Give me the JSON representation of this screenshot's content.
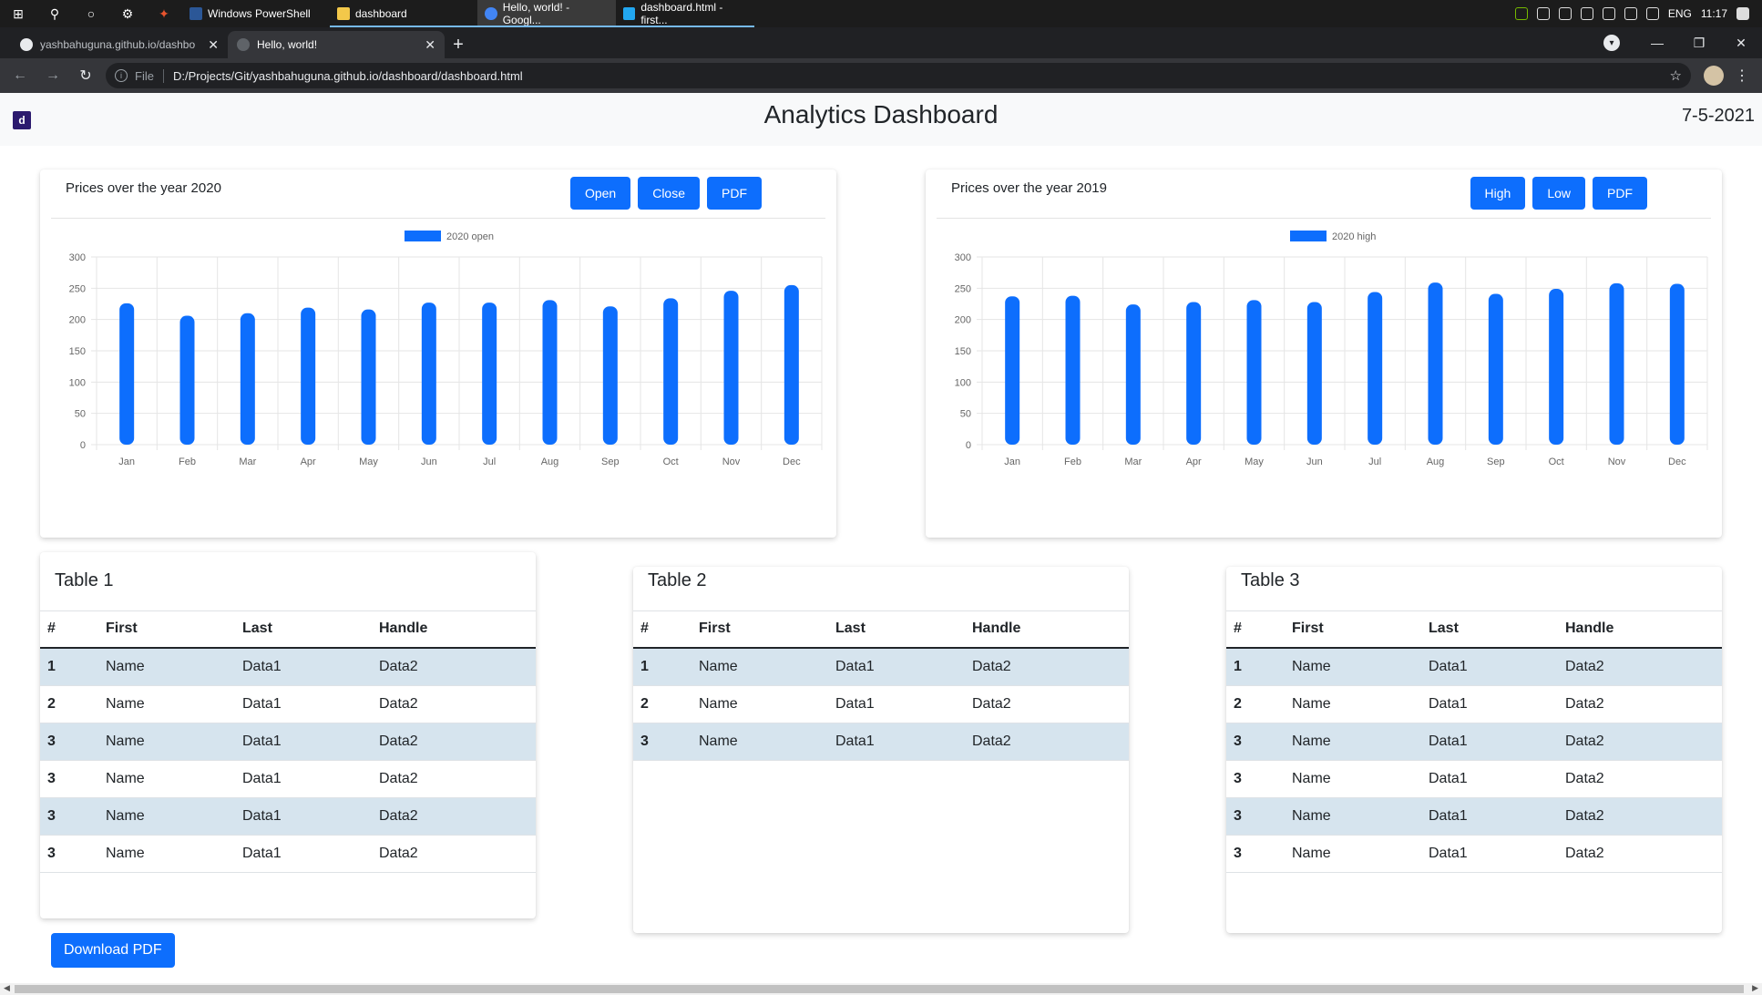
{
  "taskbar": {
    "apps": [
      {
        "label": "Windows PowerShell",
        "icon": "powershell-icon",
        "color": "#2b5797"
      },
      {
        "label": "dashboard",
        "icon": "folder-icon",
        "color": "#f3c84a"
      },
      {
        "label": "Hello, world! - Googl...",
        "icon": "chrome-icon",
        "color": "#4285f4"
      },
      {
        "label": "dashboard.html - first...",
        "icon": "vscode-icon",
        "color": "#22a7f0"
      }
    ],
    "tray": {
      "lang": "ENG",
      "time": "11:17"
    }
  },
  "browser": {
    "tabs": [
      {
        "label": "yashbahuguna.github.io/dashbo",
        "icon": "github-icon"
      },
      {
        "label": "Hello, world!",
        "icon": "globe-icon"
      }
    ],
    "url_scheme": "File",
    "url": "D:/Projects/Git/yashbahuguna.github.io/dashboard/dashboard.html"
  },
  "header": {
    "logo": "d",
    "title": "Analytics Dashboard",
    "date": "7-5-2021"
  },
  "charts": [
    {
      "title": "Prices over the year 2020",
      "buttons": [
        "Open",
        "Close",
        "PDF"
      ],
      "chart_data": {
        "type": "bar",
        "categories": [
          "Jan",
          "Feb",
          "Mar",
          "Apr",
          "May",
          "Jun",
          "Jul",
          "Aug",
          "Sep",
          "Oct",
          "Nov",
          "Dec"
        ],
        "series": [
          {
            "name": "2020 open",
            "values": [
              226,
              206,
              210,
              219,
              216,
              227,
              227,
              231,
              221,
              234,
              246,
              255
            ]
          }
        ],
        "ylim": [
          0,
          300
        ],
        "yticks": [
          0,
          50,
          100,
          150,
          200,
          250,
          300
        ],
        "grid": true,
        "legend": "top-center",
        "color": "#0d6efd"
      }
    },
    {
      "title": "Prices over the year 2019",
      "buttons": [
        "High",
        "Low",
        "PDF"
      ],
      "chart_data": {
        "type": "bar",
        "categories": [
          "Jan",
          "Feb",
          "Mar",
          "Apr",
          "May",
          "Jun",
          "Jul",
          "Aug",
          "Sep",
          "Oct",
          "Nov",
          "Dec"
        ],
        "series": [
          {
            "name": "2020 high",
            "values": [
              237,
              238,
              224,
              228,
              231,
              228,
              244,
              259,
              241,
              249,
              258,
              257
            ]
          }
        ],
        "ylim": [
          0,
          300
        ],
        "yticks": [
          0,
          50,
          100,
          150,
          200,
          250,
          300
        ],
        "grid": true,
        "legend": "top-center",
        "color": "#0d6efd"
      }
    }
  ],
  "tables": [
    {
      "title": "Table 1",
      "headers": [
        "#",
        "First",
        "Last",
        "Handle"
      ],
      "rows": [
        [
          "1",
          "Name",
          "Data1",
          "Data2"
        ],
        [
          "2",
          "Name",
          "Data1",
          "Data2"
        ],
        [
          "3",
          "Name",
          "Data1",
          "Data2"
        ],
        [
          "3",
          "Name",
          "Data1",
          "Data2"
        ],
        [
          "3",
          "Name",
          "Data1",
          "Data2"
        ],
        [
          "3",
          "Name",
          "Data1",
          "Data2"
        ]
      ]
    },
    {
      "title": "Table 2",
      "headers": [
        "#",
        "First",
        "Last",
        "Handle"
      ],
      "rows": [
        [
          "1",
          "Name",
          "Data1",
          "Data2"
        ],
        [
          "2",
          "Name",
          "Data1",
          "Data2"
        ],
        [
          "3",
          "Name",
          "Data1",
          "Data2"
        ]
      ]
    },
    {
      "title": "Table 3",
      "headers": [
        "#",
        "First",
        "Last",
        "Handle"
      ],
      "rows": [
        [
          "1",
          "Name",
          "Data1",
          "Data2"
        ],
        [
          "2",
          "Name",
          "Data1",
          "Data2"
        ],
        [
          "3",
          "Name",
          "Data1",
          "Data2"
        ],
        [
          "3",
          "Name",
          "Data1",
          "Data2"
        ],
        [
          "3",
          "Name",
          "Data1",
          "Data2"
        ],
        [
          "3",
          "Name",
          "Data1",
          "Data2"
        ]
      ]
    }
  ],
  "download_label": "Download PDF",
  "colors": {
    "accent": "#0d6efd",
    "stripe": "#d6e4ee",
    "header_bg": "#f8f9fa"
  }
}
